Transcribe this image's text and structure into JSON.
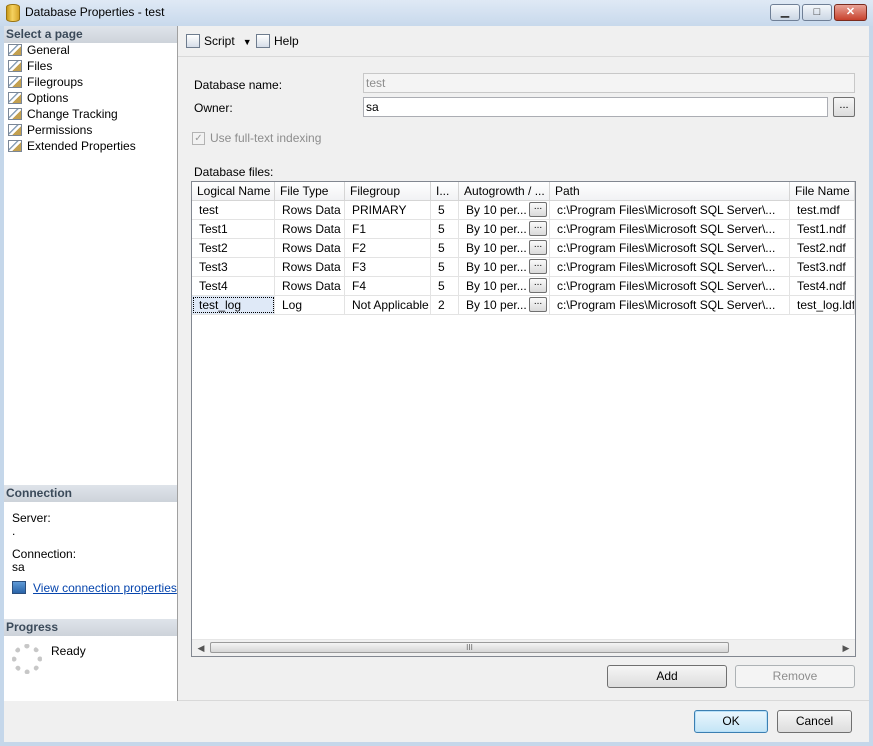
{
  "window": {
    "title": "Database Properties - test",
    "min_glyph": "▁",
    "max_glyph": "□",
    "close_glyph": "✕"
  },
  "left": {
    "select_header": "Select a page",
    "pages": [
      "General",
      "Files",
      "Filegroups",
      "Options",
      "Change Tracking",
      "Permissions",
      "Extended Properties"
    ],
    "connection_header": "Connection",
    "server_label": "Server:",
    "server_value": ".",
    "connection_label": "Connection:",
    "connection_value": "sa",
    "view_link": "View connection properties",
    "progress_header": "Progress",
    "progress_status": "Ready"
  },
  "toolbar": {
    "script_label": "Script",
    "help_label": "Help"
  },
  "form": {
    "dbname_label": "Database name:",
    "dbname_value": "test",
    "owner_label": "Owner:",
    "owner_value": "sa",
    "owner_browse": "...",
    "fulltext_label": "Use full-text indexing",
    "fulltext_checked": true,
    "files_label": "Database files:"
  },
  "grid": {
    "columns": [
      "Logical Name",
      "File Type",
      "Filegroup",
      "I...",
      "Autogrowth / ...",
      "Path",
      "File Name"
    ],
    "rows": [
      [
        "test",
        "Rows Data",
        "PRIMARY",
        "5",
        "By 10 per...",
        "c:\\Program Files\\Microsoft SQL Server\\...",
        "test.mdf"
      ],
      [
        "Test1",
        "Rows Data",
        "F1",
        "5",
        "By 10 per...",
        "c:\\Program Files\\Microsoft SQL Server\\...",
        "Test1.ndf"
      ],
      [
        "Test2",
        "Rows Data",
        "F2",
        "5",
        "By 10 per...",
        "c:\\Program Files\\Microsoft SQL Server\\...",
        "Test2.ndf"
      ],
      [
        "Test3",
        "Rows Data",
        "F3",
        "5",
        "By 10 per...",
        "c:\\Program Files\\Microsoft SQL Server\\...",
        "Test3.ndf"
      ],
      [
        "Test4",
        "Rows Data",
        "F4",
        "5",
        "By 10 per...",
        "c:\\Program Files\\Microsoft SQL Server\\...",
        "Test4.ndf"
      ],
      [
        "test_log",
        "Log",
        "Not Applicable",
        "2",
        "By 10 per...",
        "c:\\Program Files\\Microsoft SQL Server\\...",
        "test_log.ldf"
      ]
    ],
    "cell_button": "...",
    "scroll_grip": "III"
  },
  "buttons": {
    "add": "Add",
    "remove": "Remove",
    "ok": "OK",
    "cancel": "Cancel"
  }
}
